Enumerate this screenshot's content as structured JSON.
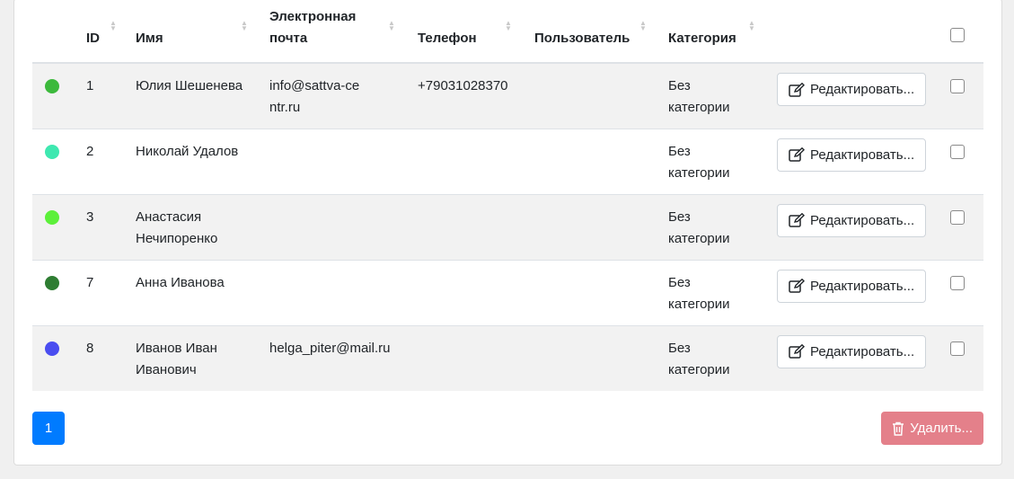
{
  "table": {
    "headers": {
      "id": "ID",
      "name": "Имя",
      "email": "Электронная почта",
      "phone": "Телефон",
      "user": "Пользователь",
      "category": "Категория"
    },
    "rows": [
      {
        "color": "#3cb93c",
        "id": "1",
        "name": "Юлия Шешенева",
        "email": "info@sattva-centr.ru",
        "phone": "+79031028370",
        "user": "",
        "category": "Без категории",
        "edit_label": "Редактировать..."
      },
      {
        "color": "#3ee8b0",
        "id": "2",
        "name": "Николай Удалов",
        "email": "",
        "phone": "",
        "user": "",
        "category": "Без категории",
        "edit_label": "Редактировать..."
      },
      {
        "color": "#5cf03a",
        "id": "3",
        "name": "Анастасия Нечипоренко",
        "email": "",
        "phone": "",
        "user": "",
        "category": "Без категории",
        "edit_label": "Редактировать..."
      },
      {
        "color": "#2e7d32",
        "id": "7",
        "name": "Анна Иванова",
        "email": "",
        "phone": "",
        "user": "",
        "category": "Без категории",
        "edit_label": "Редактировать..."
      },
      {
        "color": "#4a4df0",
        "id": "8",
        "name": "Иванов Иван Иванович",
        "email": "helga_piter@mail.ru",
        "phone": "",
        "user": "",
        "category": "Без категории",
        "edit_label": "Редактировать..."
      }
    ]
  },
  "pagination": {
    "current_page": "1"
  },
  "actions": {
    "delete_label": "Удалить..."
  },
  "colors": {
    "primary": "#007bff",
    "danger_disabled": "#e4808a"
  }
}
